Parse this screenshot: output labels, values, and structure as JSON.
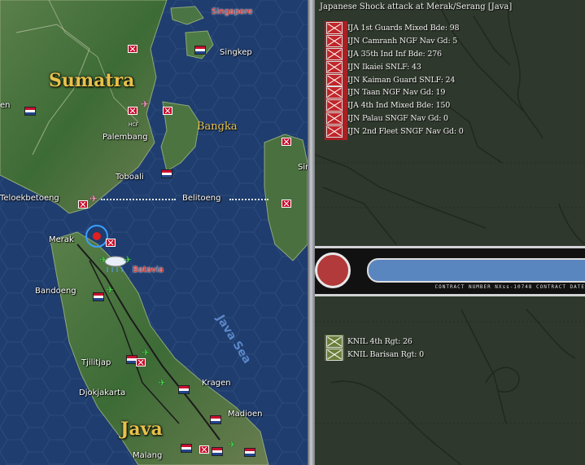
{
  "map": {
    "labels": {
      "sumatra": "Sumatra",
      "java": "Java",
      "bangka": "Bangka",
      "singapore": "Singapore",
      "singkep": "Singkep",
      "palembang": "Palembang",
      "toboali": "Toboali",
      "teloekbetoeng": "Teloekbetoeng",
      "belitoeng": "Belitoeng",
      "merak": "Merak",
      "batavia": "Batavia",
      "bandoeng": "Bandoeng",
      "tjilitjap": "Tjilitjap",
      "djokjakarta": "Djokjakarta",
      "kragen": "Kragen",
      "madioen": "Madioen",
      "malang": "Malang",
      "java_sea": "Java Sea",
      "edge_en": "en",
      "edge_sir": "Sir",
      "hcf": "HCF"
    }
  },
  "report": {
    "title": "Japanese Shock attack at Merak/Serang [Java]",
    "attackers": [
      "IJA 1st Guards Mixed Bde: 98",
      "IJN Camranh NGF Nav Gd: 5",
      "IJA 35th Ind Inf Bde: 276",
      "IJN Ikaiei SNLF: 43",
      "IJN Kaiman Guard SNLF: 24",
      "IJN Taan NGF Nav Gd: 19",
      "IJA 4th Ind Mixed Bde: 150",
      "IJN Palau SNGF Nav Gd: 0",
      "IJN 2nd Fleet SNGF Nav Gd: 0"
    ],
    "defenders": [
      "KNIL 4th Rgt: 26",
      "KNIL Barisan Rgt: 0"
    ],
    "banner_text": "CONTRACT NUMBER  NXss-10748      CONTRACT DATE"
  },
  "colors": {
    "japanese_unit": "#c0262a",
    "allied_unit": "#6b7f3a",
    "ocean": "#1e3a66",
    "land": "#3f6e3a",
    "label_gold": "#e8c14a",
    "label_red": "#e0261e"
  }
}
